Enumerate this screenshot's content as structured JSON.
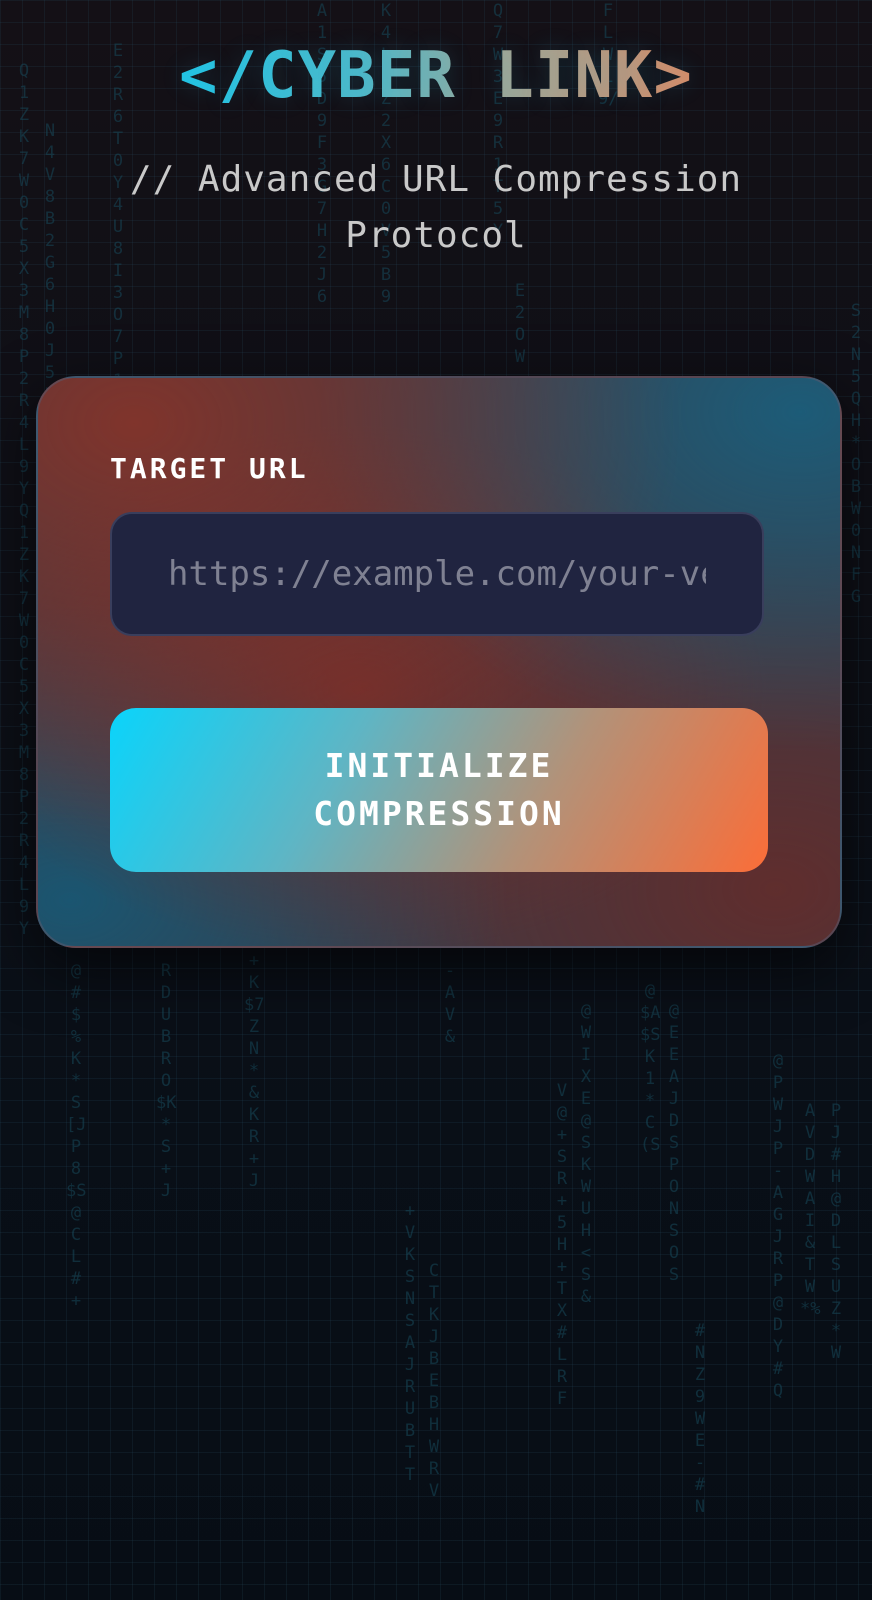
{
  "header": {
    "logo_text": "</CYBER LINK>",
    "subtitle": "// Advanced URL Compression Protocol"
  },
  "form": {
    "url_label": "TARGET URL",
    "url_placeholder": "https://example.com/your-very-long-url",
    "url_value": "",
    "submit_label": "INITIALIZE COMPRESSION"
  },
  "colors": {
    "accent_cyan": "#0ad4fb",
    "accent_orange": "#fb6d38",
    "input_background": "#202440",
    "page_background": "#0c0f17"
  }
}
